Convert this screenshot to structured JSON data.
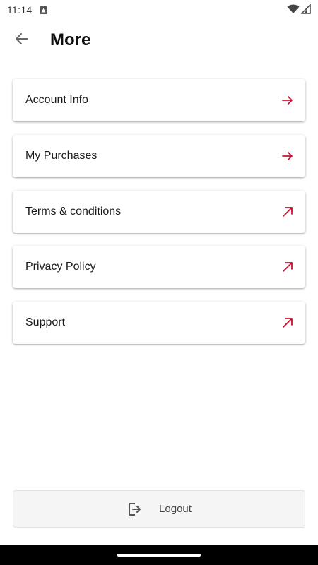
{
  "status_bar": {
    "time": "11:14",
    "icons": [
      "notification-app-icon",
      "wifi-icon",
      "signal-icon"
    ]
  },
  "header": {
    "title": "More",
    "back_icon": "arrow-left-icon"
  },
  "menu": {
    "items": [
      {
        "label": "Account Info",
        "icon": "arrow-right-icon"
      },
      {
        "label": "My Purchases",
        "icon": "arrow-right-icon"
      },
      {
        "label": "Terms & conditions",
        "icon": "external-link-icon"
      },
      {
        "label": "Privacy Policy",
        "icon": "external-link-icon"
      },
      {
        "label": "Support",
        "icon": "external-link-icon"
      }
    ]
  },
  "logout": {
    "label": "Logout",
    "icon": "logout-icon"
  },
  "colors": {
    "accent": "#c8102e",
    "background": "#ffffff",
    "logout_bg": "#f5f5f5"
  }
}
